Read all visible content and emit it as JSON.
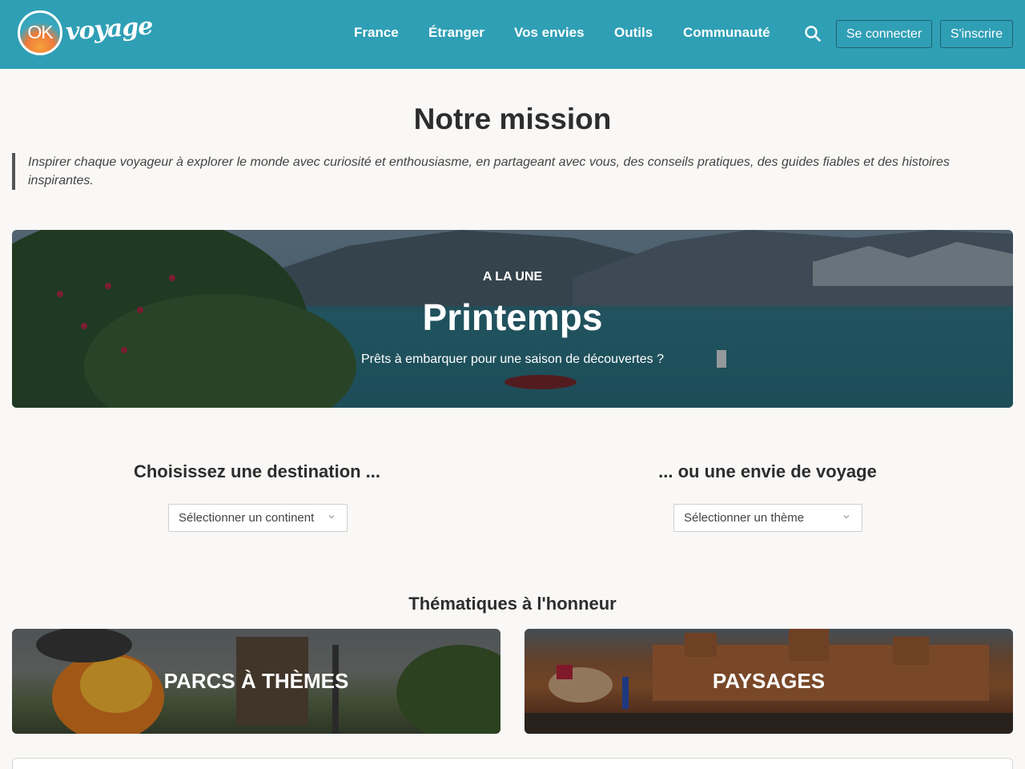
{
  "header": {
    "logo": {
      "ok": "OK",
      "voyage": "voyage"
    },
    "nav": [
      {
        "label": "France"
      },
      {
        "label": "Étranger"
      },
      {
        "label": "Vos envies"
      },
      {
        "label": "Outils"
      },
      {
        "label": "Communauté"
      }
    ],
    "search_icon": "search-icon",
    "login_label": "Se connecter",
    "signup_label": "S'inscrire",
    "color": "#2f9fb5"
  },
  "mission": {
    "title": "Notre mission",
    "quote": "Inspirer chaque voyageur à explorer le monde avec curiosité et enthousiasme, en partageant avec vous, des conseils pratiques, des guides fiables et des histoires inspirantes."
  },
  "hero": {
    "kicker": "A LA UNE",
    "title": "Printemps",
    "subtitle": "Prêts à embarquer pour une saison de découvertes ?"
  },
  "selectors": {
    "destination_title": "Choisissez une destination ...",
    "destination_value": "Sélectionner un continent",
    "envie_title": "... ou une envie de voyage",
    "envie_value": "Sélectionner un thème"
  },
  "themes": {
    "title": "Thématiques à l'honneur",
    "cards": [
      {
        "label": "PARCS À THÈMES"
      },
      {
        "label": "PAYSAGES"
      }
    ]
  }
}
